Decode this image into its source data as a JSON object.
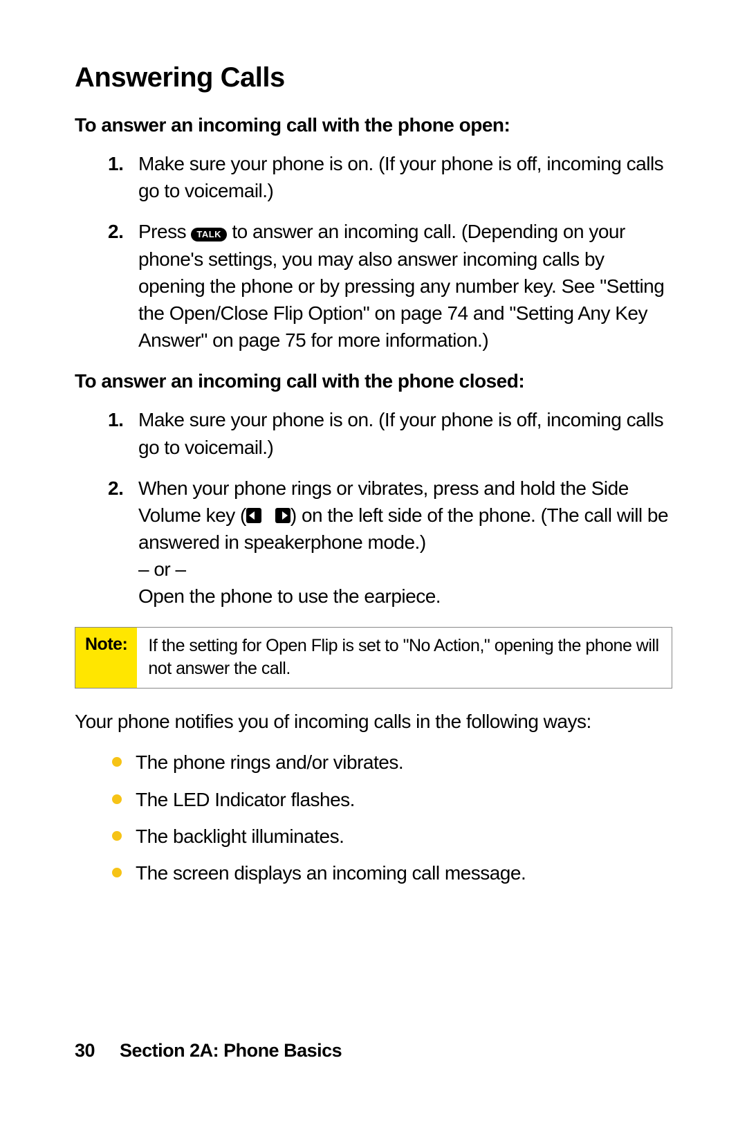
{
  "heading": "Answering Calls",
  "sub1": "To answer an incoming call with the phone open:",
  "open_steps": {
    "s1_num": "1.",
    "s1": "Make sure your phone is on. (If your phone is off, incoming calls go to voicemail.)",
    "s2_num": "2.",
    "s2_pre": "Press ",
    "s2_key": "TALK",
    "s2_post": " to answer an incoming call. (Depending on your phone's settings, you may also answer incoming calls by opening the phone or by pressing any number key. See \"Setting the Open/Close Flip Option\" on page 74 and \"Setting Any Key Answer\" on page 75 for more information.)"
  },
  "sub2": "To answer an incoming call with the phone closed:",
  "closed_steps": {
    "s1_num": "1.",
    "s1": "Make sure your phone is on. (If your phone is off, incoming calls go to voicemail.)",
    "s2_num": "2.",
    "s2_a": "When your phone rings or vibrates, press and hold the Side Volume key (",
    "s2_b": ") on the left side of the phone. (The call will be answered in speakerphone mode.)",
    "s2_or": "– or –",
    "s2_c": "Open the phone to use the earpiece."
  },
  "note": {
    "label": "Note:",
    "body": "If the setting for Open Flip is set to \"No Action,\" opening the phone will not answer the call."
  },
  "notify_intro": "Your phone notifies you of incoming calls in the following ways:",
  "bullets": [
    "The phone rings and/or vibrates.",
    "The LED Indicator flashes.",
    "The backlight illuminates.",
    "The screen displays an incoming call message."
  ],
  "footer": {
    "page": "30",
    "section": "Section 2A: Phone Basics"
  }
}
